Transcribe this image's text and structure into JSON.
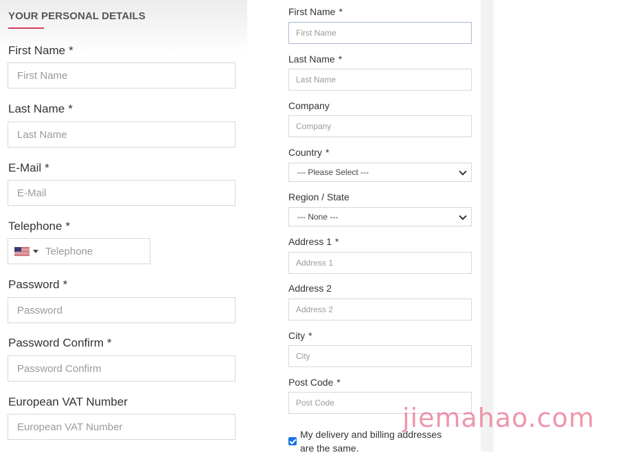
{
  "left_form": {
    "section_title": "YOUR PERSONAL DETAILS",
    "fields": [
      {
        "label": "First Name",
        "required": "*",
        "placeholder": "First Name"
      },
      {
        "label": "Last Name",
        "required": "*",
        "placeholder": "Last Name"
      },
      {
        "label": "E-Mail",
        "required": "*",
        "placeholder": "E-Mail"
      },
      {
        "label": "Telephone",
        "required": "*",
        "placeholder": "Telephone"
      },
      {
        "label": "Password",
        "required": "*",
        "placeholder": "Password"
      },
      {
        "label": "Password Confirm",
        "required": "*",
        "placeholder": "Password Confirm"
      },
      {
        "label": "European VAT Number",
        "required": "",
        "placeholder": "European VAT Number"
      }
    ],
    "telephone_country": "United States flag"
  },
  "right_form": {
    "fields": [
      {
        "label": "First Name",
        "required": "*",
        "placeholder": "First Name"
      },
      {
        "label": "Last Name",
        "required": "*",
        "placeholder": "Last Name"
      },
      {
        "label": "Company",
        "required": "",
        "placeholder": "Company"
      },
      {
        "label": "Country",
        "required": "*",
        "selected": "--- Please Select ---"
      },
      {
        "label": "Region / State",
        "required": "",
        "selected": "--- None ---"
      },
      {
        "label": "Address 1",
        "required": "*",
        "placeholder": "Address 1"
      },
      {
        "label": "Address 2",
        "required": "",
        "placeholder": "Address 2"
      },
      {
        "label": "City",
        "required": "*",
        "placeholder": "City"
      },
      {
        "label": "Post Code",
        "required": "*",
        "placeholder": "Post Code"
      }
    ],
    "same_address_checkbox": {
      "checked": true,
      "label": "My delivery and billing addresses are the same."
    }
  },
  "watermark": "jiemahao.com",
  "colors": {
    "accent": "#d23c5a",
    "checkbox": "#1a73e8",
    "watermark": "#e86e8c"
  }
}
